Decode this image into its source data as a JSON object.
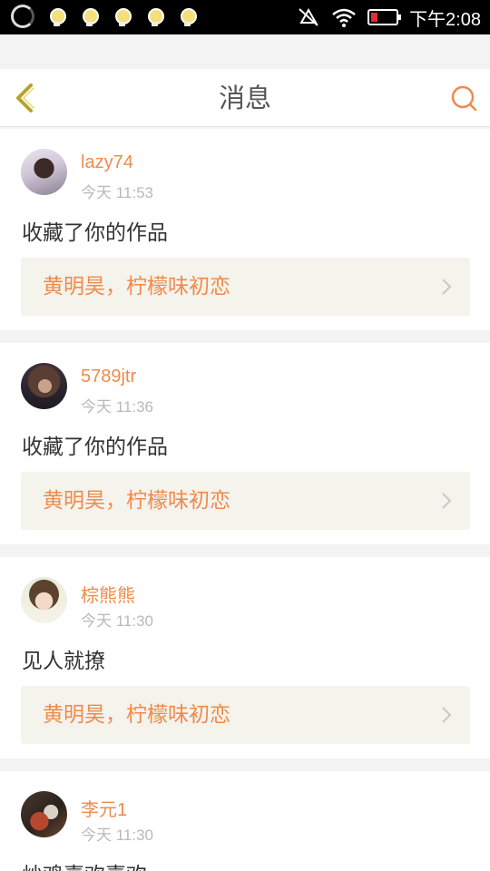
{
  "status_bar": {
    "time": "下午2:08",
    "icons": [
      "loading-ring-icon",
      "bulb-notification-icon",
      "mute-icon",
      "wifi-icon",
      "battery-low-icon"
    ]
  },
  "header": {
    "title": "消息",
    "back_icon": "chevron-left-icon",
    "search_icon": "search-icon"
  },
  "colors": {
    "accent": "#f08a4b",
    "back_icon": "#b8a32a",
    "reference_bg": "#f4f3ec"
  },
  "messages": [
    {
      "username": "lazy74",
      "time": "今天 11:53",
      "action": "收藏了你的作品",
      "reference": "黄明昊，柠檬味初恋"
    },
    {
      "username": "5789jtr",
      "time": "今天 11:36",
      "action": "收藏了你的作品",
      "reference": "黄明昊，柠檬味初恋"
    },
    {
      "username": "棕熊熊",
      "time": "今天 11:30",
      "action": "见人就撩",
      "reference": "黄明昊，柠檬味初恋"
    },
    {
      "username": "李元1",
      "time": "今天 11:30",
      "action": "炒鸡喜欢喜欢"
    }
  ]
}
